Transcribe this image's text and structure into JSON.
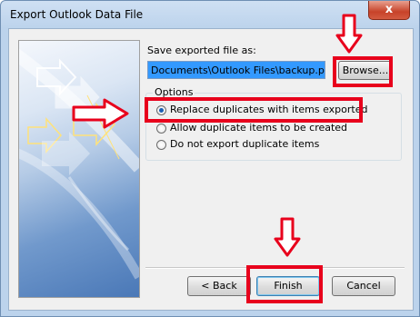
{
  "window": {
    "title": "Export Outlook Data File",
    "close_label": "x"
  },
  "save_section": {
    "label": "Save exported file as:",
    "path_value": "Documents\\Outlook Files\\backup.pst",
    "browse_label": "Browse..."
  },
  "options": {
    "group_title": "Options",
    "items": [
      {
        "label": "Replace duplicates with items exported",
        "checked": true
      },
      {
        "label": "Allow duplicate items to be created",
        "checked": false
      },
      {
        "label": "Do not export duplicate items",
        "checked": false
      }
    ]
  },
  "footer": {
    "back_label": "< Back",
    "finish_label": "Finish",
    "cancel_label": "Cancel"
  },
  "colors": {
    "highlight": "#e8001c",
    "selection": "#3399ff"
  }
}
